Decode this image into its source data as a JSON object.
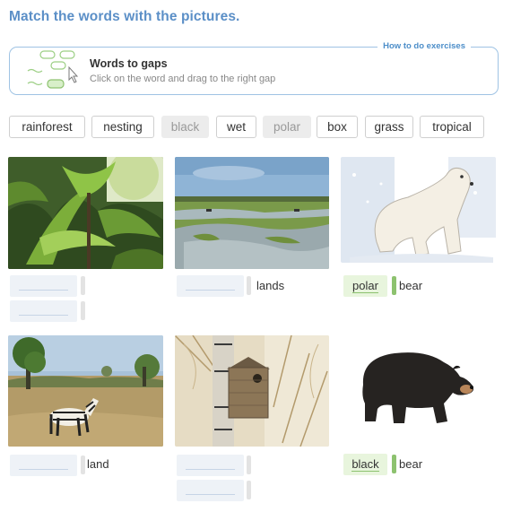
{
  "title": "Match the words with the pictures.",
  "howto": {
    "link": "How to do exercises",
    "heading": "Words to gaps",
    "description": "Click on the word and drag to the right gap"
  },
  "word_bank": [
    {
      "text": "rainforest",
      "used": false
    },
    {
      "text": "nesting",
      "used": false
    },
    {
      "text": "black",
      "used": true
    },
    {
      "text": "wet",
      "used": false
    },
    {
      "text": "polar",
      "used": true
    },
    {
      "text": "box",
      "used": false
    },
    {
      "text": "grass",
      "used": false
    },
    {
      "text": "tropical",
      "used": false
    }
  ],
  "items": [
    {
      "picture": "rainforest-photo",
      "suffix": ""
    },
    {
      "picture": "wetland-photo",
      "suffix": "lands"
    },
    {
      "picture": "polar-bear-illustration",
      "answer": "polar",
      "suffix": "bear"
    },
    {
      "picture": "zebra-grassland-photo",
      "suffix": "land"
    },
    {
      "picture": "nesting-box-photo",
      "suffix": ""
    },
    {
      "picture": "black-bear-illustration",
      "answer": "black",
      "suffix": "bear"
    }
  ],
  "colors": {
    "title": "#5b8fc7",
    "accent_green": "#8dc26f",
    "frame_border": "#9fc3e4"
  }
}
